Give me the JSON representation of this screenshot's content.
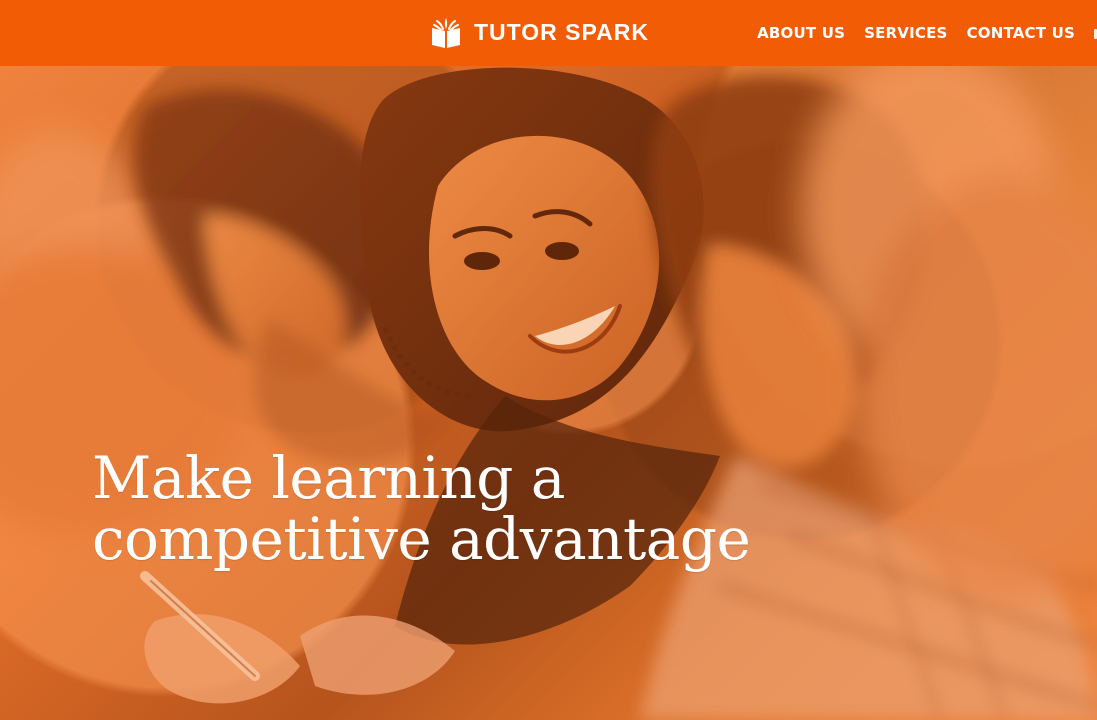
{
  "brand": {
    "name": "TUTOR SPARK",
    "icon": "book-spark-icon"
  },
  "navigation": {
    "items": [
      {
        "label": "ABOUT US"
      },
      {
        "label": "SERVICES"
      },
      {
        "label": "CONTACT US"
      }
    ]
  },
  "hero": {
    "headline_line_1": "Make learning a",
    "headline_line_2": "competitive advantage",
    "image": "students-studying-orange-photo"
  },
  "colors": {
    "brand_orange": "#f25c05",
    "hero_overlay": "#d96a28",
    "text": "#ffffff"
  }
}
